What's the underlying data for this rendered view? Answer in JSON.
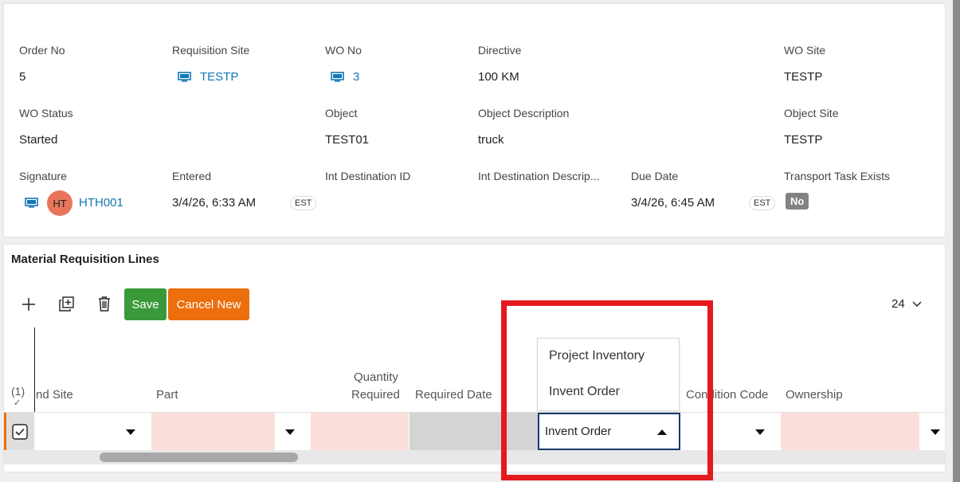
{
  "header_fields": {
    "order_no": {
      "label": "Order No",
      "value": "5"
    },
    "requisition_site": {
      "label": "Requisition Site",
      "value": "TESTP"
    },
    "wo_no": {
      "label": "WO No",
      "value": "3"
    },
    "directive": {
      "label": "Directive",
      "value": "100 KM"
    },
    "wo_site": {
      "label": "WO Site",
      "value": "TESTP"
    },
    "wo_status": {
      "label": "WO Status",
      "value": "Started"
    },
    "object": {
      "label": "Object",
      "value": "TEST01"
    },
    "object_description": {
      "label": "Object Description",
      "value": "truck"
    },
    "object_site": {
      "label": "Object Site",
      "value": "TESTP"
    },
    "signature": {
      "label": "Signature",
      "initials": "HT",
      "value": "HTH001"
    },
    "entered": {
      "label": "Entered",
      "value": "3/4/26, 6:33 AM",
      "tz": "EST"
    },
    "int_destination_id": {
      "label": "Int Destination ID"
    },
    "int_destination_desc": {
      "label": "Int Destination Descrip..."
    },
    "due_date": {
      "label": "Due Date",
      "value": "3/4/26, 6:45 AM",
      "tz": "EST"
    },
    "transport_task_exists": {
      "label": "Transport Task Exists",
      "value": "No"
    }
  },
  "lines": {
    "title": "Material Requisition Lines",
    "save_label": "Save",
    "cancel_label": "Cancel New",
    "page_size": "24",
    "selected_count": "(1)",
    "columns": {
      "demand_site": "nd Site",
      "part": "Part",
      "quantity_required_1": "Quantity",
      "quantity_required_2": "Required",
      "required_date": "Required Date",
      "condition_code": "Condition Code",
      "ownership": "Ownership"
    },
    "dropdown_options": [
      "Project Inventory",
      "Invent Order"
    ],
    "selected_option": "Invent Order"
  },
  "colors": {
    "link": "#1477b6",
    "save": "#3a9a3a",
    "cancel": "#ec6e0c",
    "required_cell": "#fbdfdb",
    "highlight": "#e3191e"
  }
}
